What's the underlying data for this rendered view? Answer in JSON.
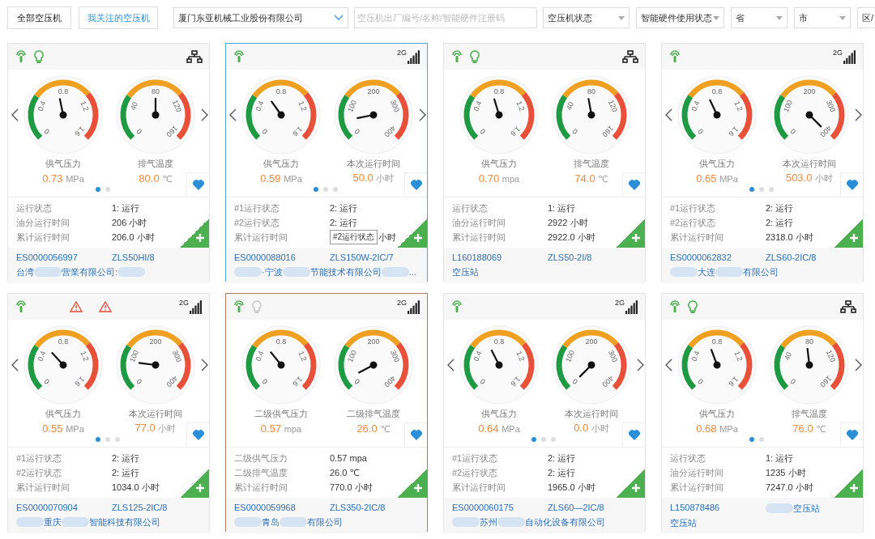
{
  "toolbar": {
    "tabs": [
      {
        "label": "全部空压机",
        "selected": true
      },
      {
        "label": "我关注的空压机",
        "selected": false
      }
    ],
    "company_select": "厦门东亚机械工业股份有限公司",
    "search": {
      "placeholder": "空压机出厂编号/名称/智能硬件注册码"
    },
    "filters": [
      "空压机状态",
      "智能硬件使用状态",
      "省",
      "市",
      "区/"
    ]
  },
  "cards": [
    {
      "selected": false,
      "lamp": {
        "lit": true
      },
      "link": {
        "kind": "network"
      },
      "arrows": true,
      "gauges": [
        {
          "ticks": [
            "0",
            "0.4",
            "0.8",
            "1.2",
            "1.6"
          ],
          "label": "供气压力",
          "value": "0.73",
          "unit": "MPa"
        },
        {
          "ticks": [
            "0",
            "40",
            "80",
            "120",
            "160"
          ],
          "label": "排气温度",
          "value": "80.0",
          "unit": "℃"
        }
      ],
      "pages": [
        {
          "selected": true
        },
        {
          "selected": false
        }
      ],
      "favorite": true,
      "info": [
        {
          "label": "运行状态",
          "value": "1: 运行"
        },
        {
          "label": "油分运行时间",
          "value": "206 小时"
        },
        {
          "label": "累计运行时间",
          "value": "206.0 小时"
        }
      ],
      "code": "ES0000056997",
      "model": [
        {
          "kind": "text",
          "text": "ZLS50HI/8"
        }
      ],
      "company": [
        {
          "kind": "text",
          "text": "台湾"
        },
        {
          "kind": "mask"
        },
        {
          "kind": "text",
          "text": "营業有限公司:"
        },
        {
          "kind": "mask"
        }
      ]
    },
    {
      "selected": true,
      "link": {
        "kind": "cellular",
        "label": "2G"
      },
      "arrows": true,
      "gauges": [
        {
          "ticks": [
            "0",
            "0.4",
            "0.8",
            "1.2",
            "1.6"
          ],
          "label": "供气压力",
          "value": "0.59",
          "unit": "MPa"
        },
        {
          "ticks": [
            "0",
            "100",
            "200",
            "300",
            "400"
          ],
          "label": "本次运行时间",
          "value": "50.0",
          "unit": "小时"
        }
      ],
      "pages": [
        {
          "selected": true
        },
        {
          "selected": false
        },
        {
          "selected": false
        }
      ],
      "favorite": true,
      "info": [
        {
          "label": "#1运行状态",
          "value": "2: 运行"
        },
        {
          "label": "#2运行状态",
          "value": "2: 运行"
        },
        {
          "label": "累计运行时间",
          "tooltip": "#2运行状态",
          "value": "小时"
        }
      ],
      "code": "ES0000088016",
      "model": [
        {
          "kind": "text",
          "text": "ZLS150W-2IC/7"
        }
      ],
      "company": [
        {
          "kind": "mask"
        },
        {
          "kind": "text",
          "text": "·宁波"
        },
        {
          "kind": "mask"
        },
        {
          "kind": "text",
          "text": "节能技术有限公司"
        },
        {
          "kind": "mask"
        },
        {
          "kind": "text",
          "text": "..."
        }
      ]
    },
    {
      "selected": false,
      "lamp": {
        "lit": true
      },
      "link": {
        "kind": "network"
      },
      "arrows": false,
      "gauges": [
        {
          "ticks": [
            "0",
            "0.4",
            "0.8",
            "1.2",
            "1.6"
          ],
          "label": "供气压力",
          "value": "0.70",
          "unit": "mpa"
        },
        {
          "ticks": [
            "0",
            "40",
            "80",
            "120",
            "160"
          ],
          "label": "排气温度",
          "value": "74.0",
          "unit": "℃"
        }
      ],
      "favorite": true,
      "info": [
        {
          "label": "运行状态",
          "value": "1: 运行"
        },
        {
          "label": "油分运行时间",
          "value": "2922 小时"
        },
        {
          "label": "累计运行时间",
          "value": "2922.0 小时"
        }
      ],
      "code": "L160188069",
      "model": [
        {
          "kind": "text",
          "text": "ZLS50-2I/8"
        }
      ],
      "company": [
        {
          "kind": "text",
          "text": "空压站"
        }
      ]
    },
    {
      "selected": false,
      "link": {
        "kind": "cellular",
        "label": "2G"
      },
      "arrows": true,
      "gauges": [
        {
          "ticks": [
            "0",
            "0.4",
            "0.8",
            "1.2",
            "1.6"
          ],
          "label": "供气压力",
          "value": "0.65",
          "unit": "MPa"
        },
        {
          "ticks": [
            "0",
            "100",
            "200",
            "300",
            "400"
          ],
          "label": "本次运行时间",
          "value": "503.0",
          "unit": "小时"
        }
      ],
      "pages": [
        {
          "selected": true
        },
        {
          "selected": false
        },
        {
          "selected": false
        }
      ],
      "favorite": true,
      "info": [
        {
          "label": "#1运行状态",
          "value": "2: 运行"
        },
        {
          "label": "#2运行状态",
          "value": "2: 运行"
        },
        {
          "label": "累计运行时间",
          "value": "2318.0 小时"
        }
      ],
      "code": "ES0000062832",
      "model": [
        {
          "kind": "text",
          "text": "ZLS60-2IC/8"
        }
      ],
      "company": [
        {
          "kind": "mask"
        },
        {
          "kind": "text",
          "text": "大连"
        },
        {
          "kind": "mask"
        },
        {
          "kind": "text",
          "text": "有限公司"
        }
      ]
    },
    {
      "selected": false,
      "alarm": true,
      "link": {
        "kind": "cellular",
        "label": "2G"
      },
      "arrows": true,
      "gauges": [
        {
          "ticks": [
            "0",
            "0.4",
            "0.8",
            "1.2",
            "1.6"
          ],
          "label": "供气压力",
          "value": "0.55",
          "unit": "MPa"
        },
        {
          "ticks": [
            "0",
            "100",
            "200",
            "300",
            "400"
          ],
          "label": "本次运行时间",
          "value": "77.0",
          "unit": "小时"
        }
      ],
      "pages": [
        {
          "selected": true
        },
        {
          "selected": false
        },
        {
          "selected": false
        }
      ],
      "favorite": true,
      "info": [
        {
          "label": "#1运行状态",
          "value": "2: 运行"
        },
        {
          "label": "#2运行状态",
          "value": "2: 运行"
        },
        {
          "label": "累计运行时间",
          "value": "1034.0 小时"
        }
      ],
      "code": "ES0000070904",
      "model": [
        {
          "kind": "text",
          "text": "ZLS125-2IC/8"
        }
      ],
      "company": [
        {
          "kind": "mask"
        },
        {
          "kind": "text",
          "text": "重庆"
        },
        {
          "kind": "mask"
        },
        {
          "kind": "text",
          "text": "智能科技有限公司"
        }
      ]
    },
    {
      "selected": false,
      "highlighted": true,
      "lamp": {
        "lit": false
      },
      "link": {
        "kind": "cellular",
        "label": "2G"
      },
      "arrows": false,
      "gauges": [
        {
          "ticks": [
            "0",
            "0.4",
            "0.8",
            "1.2",
            "1.6"
          ],
          "label": "二级供气压力",
          "value": "0.57",
          "unit": "mpa"
        },
        {
          "ticks": [
            "0",
            "100",
            "200",
            "300",
            "400"
          ],
          "label": "二级排气温度",
          "value": "26.0",
          "unit": "℃"
        }
      ],
      "favorite": true,
      "info": [
        {
          "label": "二级供气压力",
          "value": "0.57 mpa"
        },
        {
          "label": "二级排气温度",
          "value": "26.0 ℃"
        },
        {
          "label": "累计运行时间",
          "value": "770.0 小时"
        }
      ],
      "code": "ES0000059968",
      "model": [
        {
          "kind": "text",
          "text": "ZLS350-2IC/8"
        }
      ],
      "company": [
        {
          "kind": "mask"
        },
        {
          "kind": "text",
          "text": "青岛"
        },
        {
          "kind": "mask"
        },
        {
          "kind": "text",
          "text": "有限公司"
        }
      ]
    },
    {
      "selected": false,
      "link": {
        "kind": "cellular",
        "label": "2G"
      },
      "arrows": true,
      "gauges": [
        {
          "ticks": [
            "0",
            "0.4",
            "0.8",
            "1.2",
            "1.6"
          ],
          "label": "供气压力",
          "value": "0.64",
          "unit": "MPa"
        },
        {
          "ticks": [
            "0",
            "100",
            "200",
            "300",
            "400"
          ],
          "label": "本次运行时间",
          "value": "0.0",
          "unit": "小时"
        }
      ],
      "pages": [
        {
          "selected": true
        },
        {
          "selected": false
        },
        {
          "selected": false
        }
      ],
      "favorite": true,
      "info": [
        {
          "label": "#1运行状态",
          "value": "2: 运行"
        },
        {
          "label": "#2运行状态",
          "value": "2: 运行"
        },
        {
          "label": "累计运行时间",
          "value": "1965.0 小时"
        }
      ],
      "code": "ES0000060175",
      "model": [
        {
          "kind": "text",
          "text": "ZLS60—2IC/8"
        }
      ],
      "company": [
        {
          "kind": "mask"
        },
        {
          "kind": "text",
          "text": "苏州"
        },
        {
          "kind": "mask"
        },
        {
          "kind": "text",
          "text": "自动化设备有限公司"
        }
      ]
    },
    {
      "selected": false,
      "lamp": {
        "lit": true
      },
      "link": {
        "kind": "network"
      },
      "arrows": true,
      "gauges": [
        {
          "ticks": [
            "0",
            "0.4",
            "0.8",
            "1.2",
            "1.6"
          ],
          "label": "供气压力",
          "value": "0.68",
          "unit": "MPa"
        },
        {
          "ticks": [
            "0",
            "40",
            "80",
            "120",
            "160"
          ],
          "label": "排气温度",
          "value": "76.0",
          "unit": "℃"
        }
      ],
      "pages": [
        {
          "selected": true
        },
        {
          "selected": false
        }
      ],
      "favorite": true,
      "info": [
        {
          "label": "运行状态",
          "value": "1: 运行"
        },
        {
          "label": "油分运行时间",
          "value": "1235 小时"
        },
        {
          "label": "累计运行时间",
          "value": "7247.0 小时"
        }
      ],
      "code": "L150878486",
      "model": [
        {
          "kind": "mask"
        },
        {
          "kind": "text",
          "text": "空压站"
        }
      ],
      "company": [
        {
          "kind": "text",
          "text": "空压站"
        }
      ]
    }
  ]
}
